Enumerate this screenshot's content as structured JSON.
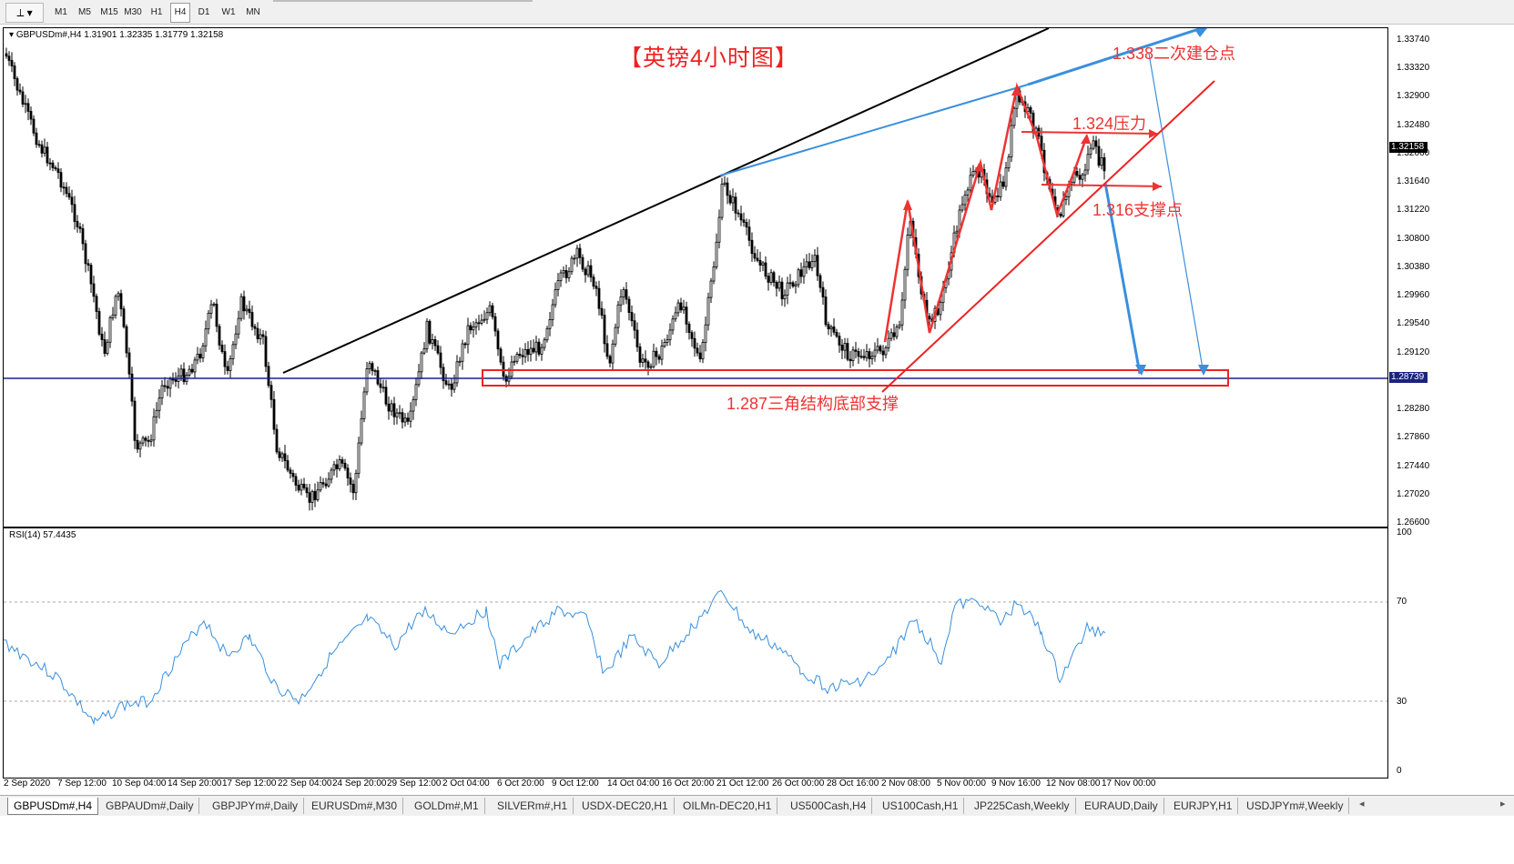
{
  "toolbar": {
    "tool_icon": "drawing-tools-icon",
    "timeframes": [
      "M1",
      "M5",
      "M15",
      "M30",
      "H1",
      "H4",
      "D1",
      "W1",
      "MN"
    ],
    "active_timeframe": "H4"
  },
  "chart": {
    "symbol_line": "GBPUSDm#,H4  1.31901 1.32335 1.31779 1.32158",
    "title": "【英镑4小时图】",
    "current_price": "1.32158",
    "hline_price": "1.28739",
    "price_ticks": [
      "1.33740",
      "1.33320",
      "1.32900",
      "1.32480",
      "1.32060",
      "1.31640",
      "1.31220",
      "1.30800",
      "1.30380",
      "1.29960",
      "1.29540",
      "1.29120",
      "1.28280",
      "1.27860",
      "1.27440",
      "1.27020",
      "1.26600"
    ],
    "annotations": {
      "reentry": "1.338二次建仓点",
      "resistance": "1.324压力",
      "support": "1.316支撑点",
      "triangle_support": "1.287三角结构底部支撑"
    },
    "colors": {
      "up": "#000000",
      "down": "#000000",
      "hline": "#1a237e",
      "annotation": "#ee3333",
      "projection": "#3a8fdd",
      "rsi_line": "#3a8fdd"
    }
  },
  "rsi": {
    "title": "RSI(14) 57.4435",
    "levels": [
      "100",
      "70",
      "30",
      "0"
    ]
  },
  "xaxis": {
    "labels": [
      "2 Sep 2020",
      "7 Sep 12:00",
      "10 Sep 04:00",
      "14 Sep 20:00",
      "17 Sep 12:00",
      "22 Sep 04:00",
      "24 Sep 20:00",
      "29 Sep 12:00",
      "2 Oct 04:00",
      "6 Oct 20:00",
      "9 Oct 12:00",
      "14 Oct 04:00",
      "16 Oct 20:00",
      "21 Oct 12:00",
      "26 Oct 00:00",
      "28 Oct 16:00",
      "2 Nov 08:00",
      "5 Nov 00:00",
      "9 Nov 16:00",
      "12 Nov 08:00",
      "17 Nov 00:00"
    ]
  },
  "tabs": [
    "GBPUSDm#,H4",
    "GBPAUDm#,Daily",
    "GBPJPYm#,Daily",
    "EURUSDm#,M30",
    "GOLDm#,M1",
    "SILVERm#,H1",
    "USDX-DEC20,H1",
    "OILMn-DEC20,H1",
    "US500Cash,H4",
    "US100Cash,H1",
    "JP225Cash,Weekly",
    "EURAUD,Daily",
    "EURJPY,H1",
    "USDJPYm#,Weekly"
  ],
  "active_tab": "GBPUSDm#,H4"
}
